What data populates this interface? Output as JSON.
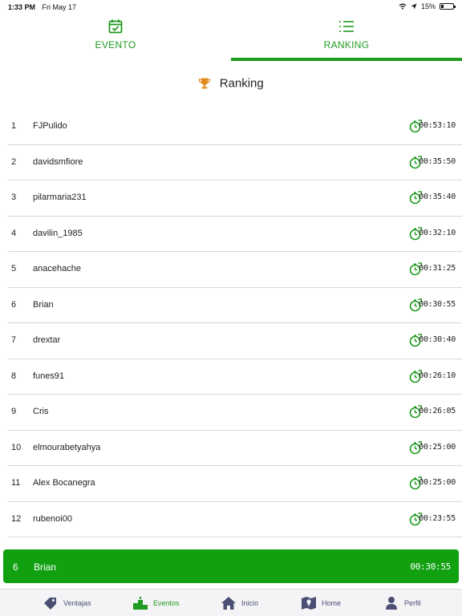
{
  "status_bar": {
    "time": "1:33 PM",
    "date": "Fri May 17",
    "battery": "15%"
  },
  "tabs": [
    {
      "label": "EVENTO",
      "icon": "calendar-check-icon",
      "active": false
    },
    {
      "label": "RANKING",
      "icon": "list-icon",
      "active": true
    }
  ],
  "heading": {
    "icon": "trophy-icon",
    "title": "Ranking"
  },
  "ranking": [
    {
      "pos": "1",
      "name": "FJPulido",
      "time": "00:53:10"
    },
    {
      "pos": "2",
      "name": "davidsmfiore",
      "time": "00:35:50"
    },
    {
      "pos": "3",
      "name": "pilarmaria231",
      "time": "00:35:40"
    },
    {
      "pos": "4",
      "name": "davilin_1985",
      "time": "00:32:10"
    },
    {
      "pos": "5",
      "name": "anacehache",
      "time": "00:31:25"
    },
    {
      "pos": "6",
      "name": "Brian",
      "time": "00:30:55"
    },
    {
      "pos": "7",
      "name": "drextar",
      "time": "00:30:40"
    },
    {
      "pos": "8",
      "name": "funes91",
      "time": "00:26:10"
    },
    {
      "pos": "9",
      "name": "Cris",
      "time": "00:26:05"
    },
    {
      "pos": "10",
      "name": "elmourabetyahya",
      "time": "00:25:00"
    },
    {
      "pos": "11",
      "name": "Alex Bocanegra",
      "time": "00:25:00"
    },
    {
      "pos": "12",
      "name": "rubenoi00",
      "time": "00:23:55"
    }
  ],
  "current_user": {
    "pos": "6",
    "name": "Brian",
    "time": "00:30:55"
  },
  "bottom_nav": [
    {
      "label": "Ventajas",
      "icon": "tag-icon",
      "active": false
    },
    {
      "label": "Eventos",
      "icon": "podium-icon",
      "active": true
    },
    {
      "label": "Inicio",
      "icon": "house-icon",
      "active": false
    },
    {
      "label": "Home",
      "icon": "map-icon",
      "active": false
    },
    {
      "label": "Perfil",
      "icon": "person-icon",
      "active": false
    }
  ],
  "colors": {
    "accent": "#1f9b1f",
    "highlight": "#10a010",
    "nav_text": "#4a4f73"
  }
}
